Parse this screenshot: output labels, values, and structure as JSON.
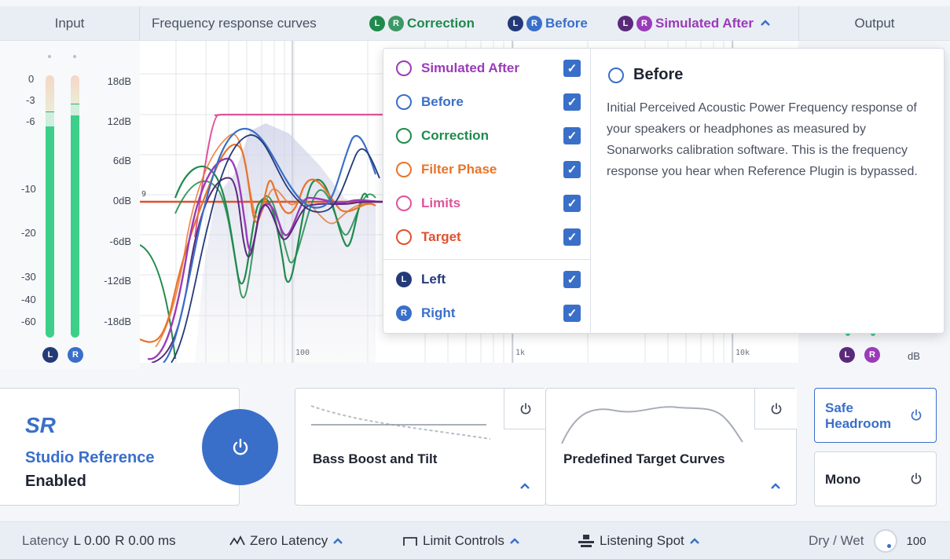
{
  "header": {
    "input_label": "Input",
    "graph_label": "Frequency response curves",
    "output_label": "Output",
    "legend": [
      {
        "name": "Correction",
        "color": "#1f8a4c",
        "l_color": "#1f8a4c",
        "r_color": "#1f8a4c"
      },
      {
        "name": "Before",
        "color": "#3a6fc9",
        "l_color": "#243a78",
        "r_color": "#3a6fc9"
      },
      {
        "name": "Simulated After",
        "color": "#9a3bb8",
        "l_color": "#5a2a7a",
        "r_color": "#9a3bb8"
      }
    ],
    "legend_l": "L",
    "legend_r": "R"
  },
  "input_meter": {
    "scale": [
      "0",
      "-3",
      "-6",
      "-10",
      "-20",
      "-30",
      "-40",
      "-60"
    ],
    "left_label": "L",
    "right_label": "R",
    "left_level": 0.86,
    "right_level": 0.86
  },
  "graph": {
    "db_ticks": [
      "18dB",
      "12dB",
      "6dB",
      "0dB",
      "-6dB",
      "-12dB",
      "-18dB"
    ],
    "freq_ticks": [
      "100",
      "1k",
      "10k"
    ],
    "marker": "9"
  },
  "dropdown": {
    "items": [
      {
        "label": "Simulated After",
        "color": "#9a3bb8",
        "checked": true
      },
      {
        "label": "Before",
        "color": "#3a6fc9",
        "checked": true
      },
      {
        "label": "Correction",
        "color": "#1f8a4c",
        "checked": true
      },
      {
        "label": "Filter Phase",
        "color": "#e8742a",
        "checked": true
      },
      {
        "label": "Limits",
        "color": "#e0529b",
        "checked": true
      },
      {
        "label": "Target",
        "color": "#e0512e",
        "checked": true
      }
    ],
    "channels": [
      {
        "label": "Left",
        "badge": "L",
        "color": "#243a78",
        "checked": true
      },
      {
        "label": "Right",
        "badge": "R",
        "color": "#3a6fc9",
        "checked": true
      }
    ],
    "detail_title": "Before",
    "detail_text": "Initial Perceived Acoustic Power Frequency response of your speakers or headphones as measured by Sonarworks calibration software. This is the frequency response you hear when Reference Plugin is bypassed.",
    "checkmark": "✓"
  },
  "output_meter": {
    "left_label": "L",
    "right_label": "R",
    "unit": "dB"
  },
  "studio_reference": {
    "logo": "SR",
    "name": "Studio Reference",
    "status": "Enabled"
  },
  "modules": {
    "bass_boost": "Bass Boost and Tilt",
    "target_curves": "Predefined Target Curves",
    "safe_headroom_line1": "Safe",
    "safe_headroom_line2": "Headroom",
    "mono": "Mono"
  },
  "statusbar": {
    "latency_label": "Latency",
    "latency_l": "L 0.00",
    "latency_r": "R 0.00 ms",
    "zero_latency": "Zero Latency",
    "limit_controls": "Limit Controls",
    "listening_spot": "Listening Spot",
    "dry_wet": "Dry / Wet",
    "dry_wet_value": "100"
  },
  "icons": {
    "power": "⏻",
    "chevron_up": "⌃"
  }
}
